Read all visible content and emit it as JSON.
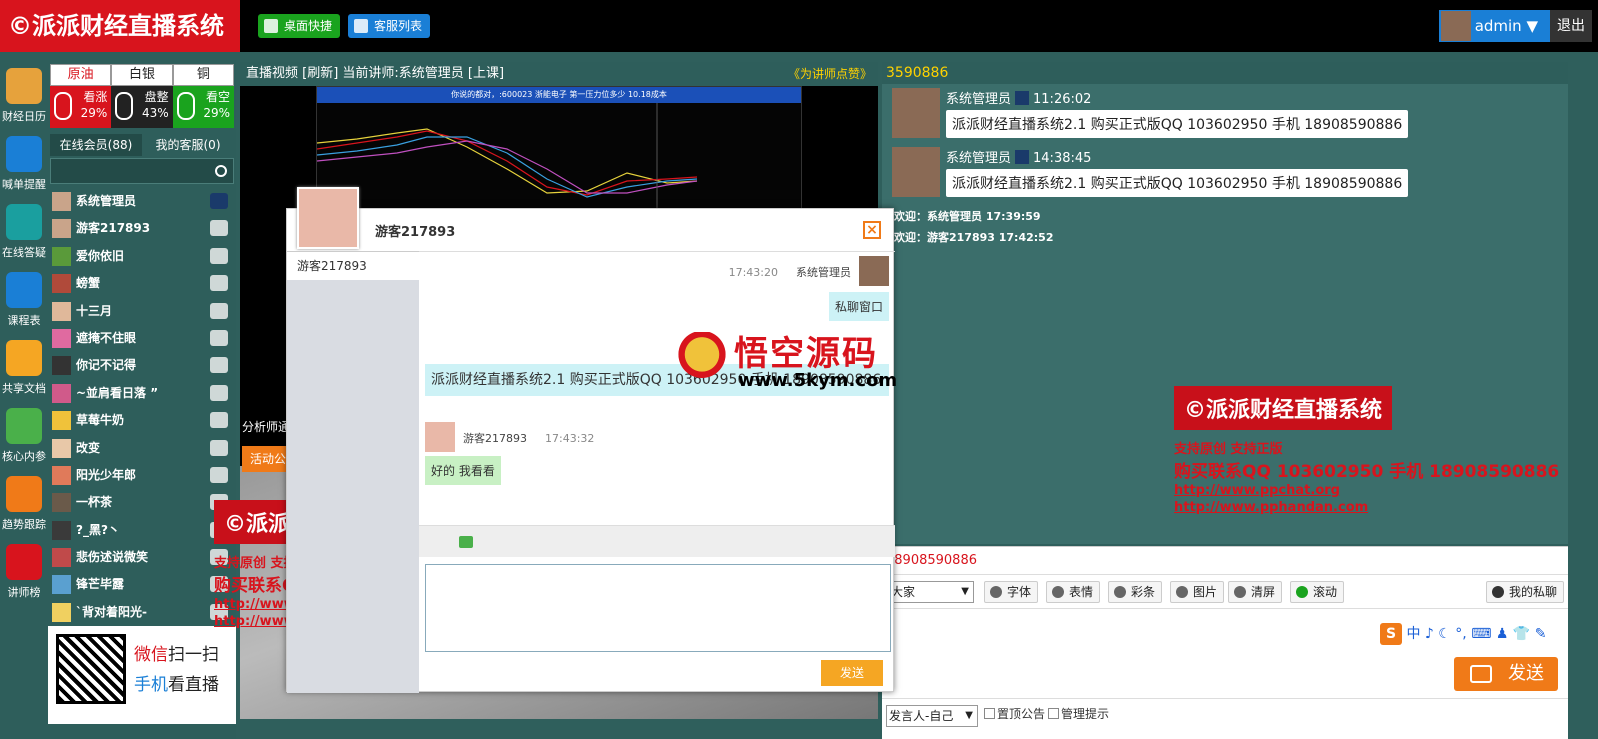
{
  "header": {
    "brand": "©派派财经直播系统",
    "desktop_shortcut": "桌面快捷",
    "service_list": "客服列表",
    "username": "admin ▼",
    "logout": "退出"
  },
  "rail": [
    {
      "label": "财经日历",
      "icon": "calendar-icon",
      "color": "#e6a23c"
    },
    {
      "label": "喊单提醒",
      "icon": "megaphone-icon",
      "color": "#1a7fd6"
    },
    {
      "label": "在线答疑",
      "icon": "question-icon",
      "color": "#1a9f9f"
    },
    {
      "label": "课程表",
      "icon": "course-icon",
      "color": "#1a7fd6"
    },
    {
      "label": "共享文档",
      "icon": "share-doc-icon",
      "color": "#f5a623"
    },
    {
      "label": "核心内参",
      "icon": "edit-icon",
      "color": "#4ab04a"
    },
    {
      "label": "趋势跟踪",
      "icon": "dollar-icon",
      "color": "#f07a18"
    },
    {
      "label": "讲师榜",
      "icon": "chart-icon",
      "color": "#d8141d"
    }
  ],
  "prices": {
    "tabs": [
      "原油",
      "白银",
      "铜"
    ],
    "cells": [
      {
        "label": "看涨",
        "value": "29%"
      },
      {
        "label": "盘整",
        "value": "43%"
      },
      {
        "label": "看空",
        "value": "29%"
      }
    ]
  },
  "online": {
    "tab_members": "在线会员(88)",
    "tab_service": "我的客服(0)"
  },
  "members": [
    "系统管理员",
    "游客217893",
    "爱你依旧",
    "螃蟹",
    "十三月",
    "遮掩不住眼",
    "你记不记得",
    "~並肩看日落 ”",
    "草莓牛奶",
    "改变",
    "阳光少年郎",
    "一杯茶",
    "?_黑?丶",
    "悲伤述说微笑",
    "锋芒毕露",
    "`背对着阳光-"
  ],
  "qr": {
    "wechat": "微信",
    "scan": "扫一扫",
    "mobile": "手机",
    "watch": "看直播"
  },
  "video": {
    "header": "直播视频 [刷新] 当前讲师:系统管理员 [上课]",
    "praise": "《为讲师点赞》",
    "chart_bar": "你说的都对，:600023 浙能电子 第一压力位多少 10.18成本",
    "analyst": "分析师通",
    "activity": "活动公"
  },
  "dialog": {
    "title": "游客217893",
    "close": "×",
    "side_item": "游客217893",
    "msg1_time": "17:43:20",
    "msg1_user": "系统管理员",
    "msg1_text": "私聊窗口",
    "msg2_text": "派派财经直播系统2.1 购买正式版QQ 103602950 手机 18908590886",
    "msg3_user": "游客217893",
    "msg3_time": "17:43:32",
    "msg3_text": "好的 我看看",
    "send": "发送"
  },
  "watermark": {
    "cn": "悟空源码",
    "url": "www.5kym.com"
  },
  "promo": {
    "tag": "©派派财经直播系统",
    "line1": "支持原创 支持正版",
    "line2": "购买联系QQ 103602950 手机 18908590886",
    "url1": "http://www.ppchat.org",
    "url2": "http://www.pphandan.com"
  },
  "chat": {
    "head": "3590886",
    "messages": [
      {
        "user": "系统管理员",
        "time": "11:26:02",
        "text": "派派财经直播系统2.1 购买正式版QQ 103602950 手机 18908590886"
      },
      {
        "user": "系统管理员",
        "time": "14:38:45",
        "text": "派派财经直播系统2.1 购买正式版QQ 103602950 手机 18908590886"
      }
    ],
    "welcome1": "欢迎：系统管理员 17:39:59",
    "welcome2": "欢迎：游客217893 17:42:52",
    "notice": "18908590886",
    "target": "大家",
    "tools": [
      "字体",
      "表情",
      "彩条",
      "图片",
      "清屏",
      "滚动"
    ],
    "private": "我的私聊",
    "ime": "中 ♪ ☾ °, ⌨ ♟ 👕 ✎",
    "send": "发送",
    "speaker": "发言人-自己",
    "pin": "置顶公告",
    "admin_tip": "管理提示"
  }
}
